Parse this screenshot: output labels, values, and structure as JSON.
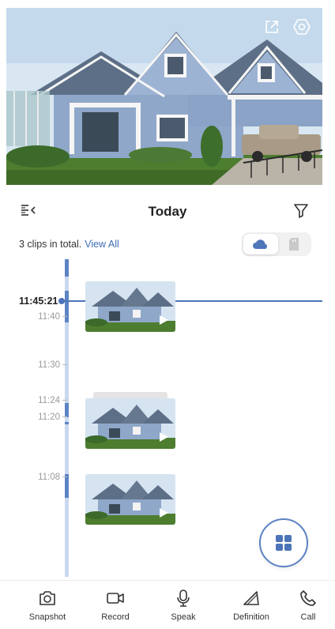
{
  "header": {
    "title": "Today",
    "menu_icon": "timeline-collapse-icon",
    "filter_icon": "filter-icon"
  },
  "live_view": {
    "share_icon": "share-icon",
    "settings_icon": "settings-hex-icon"
  },
  "summary": {
    "clips_text": "3 clips in total.",
    "view_all": "View All"
  },
  "storage_toggle": {
    "options": [
      "cloud",
      "sd-card"
    ],
    "selected": "cloud"
  },
  "timeline": {
    "current_time": "11:45:21",
    "ticks": [
      "11:40",
      "11:30",
      "11:24",
      "11:20",
      "11:08"
    ]
  },
  "clips": [
    {
      "name": "clip-1"
    },
    {
      "name": "clip-2"
    },
    {
      "name": "clip-3"
    }
  ],
  "toolbar": {
    "items": [
      {
        "label": "Snapshot",
        "icon": "camera-icon"
      },
      {
        "label": "Record",
        "icon": "video-icon"
      },
      {
        "label": "Speak",
        "icon": "microphone-icon"
      },
      {
        "label": "Definition",
        "icon": "definition-icon"
      },
      {
        "label": "Call",
        "icon": "phone-icon"
      }
    ]
  },
  "fab": {
    "icon": "grid-icon"
  },
  "colors": {
    "accent": "#4d74b8",
    "timeline_track": "#c9d8ee",
    "timeline_segment": "#5c84c4",
    "link": "#3f6db5"
  }
}
